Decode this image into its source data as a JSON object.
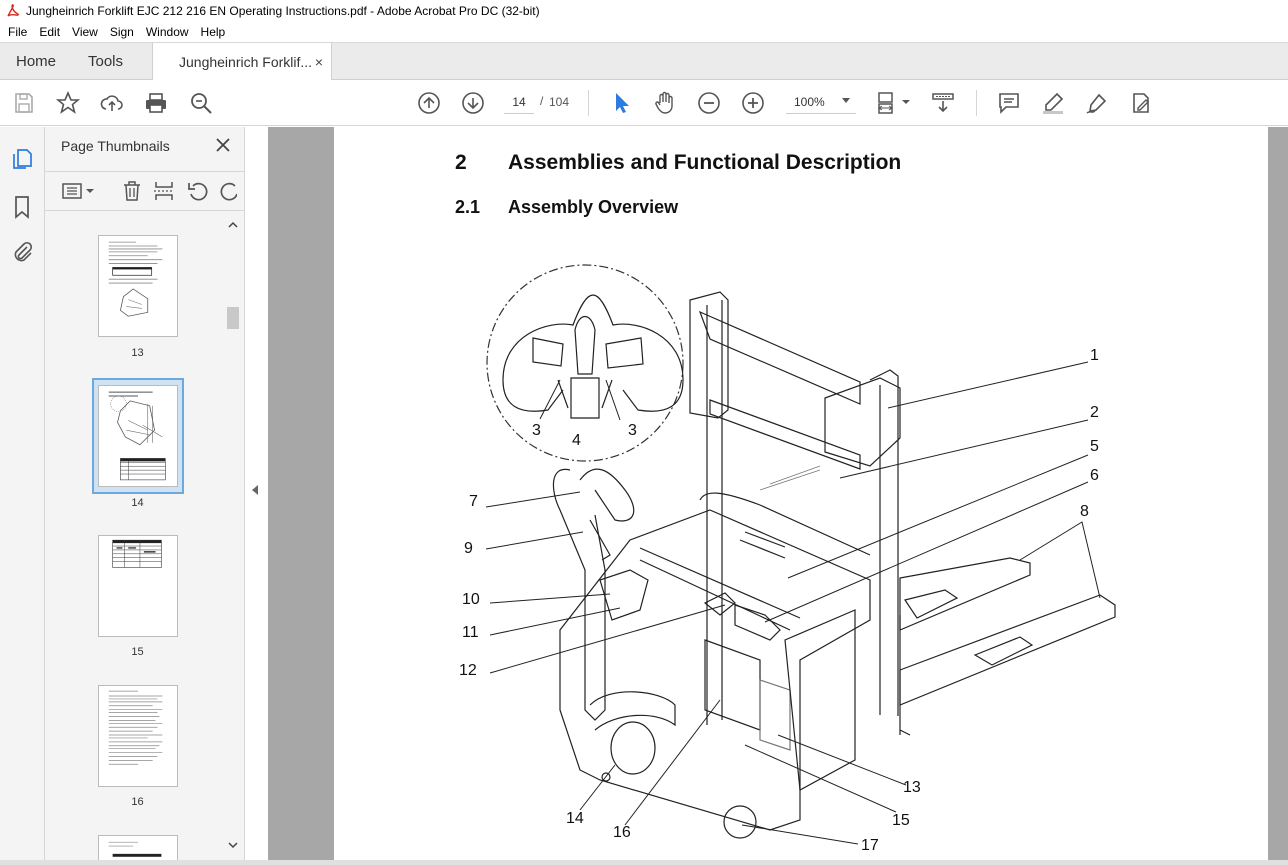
{
  "window": {
    "title": "Jungheinrich Forklift EJC 212 216 EN Operating Instructions.pdf - Adobe Acrobat Pro DC (32-bit)"
  },
  "menu": [
    "File",
    "Edit",
    "View",
    "Sign",
    "Window",
    "Help"
  ],
  "tabs": {
    "home": "Home",
    "tools": "Tools",
    "document": "Jungheinrich Forklif...",
    "close_glyph": "×"
  },
  "toolbar": {
    "page_current": "14",
    "page_separator": "/",
    "page_total": "104",
    "zoom": "100%"
  },
  "thumbnails": {
    "panel_title": "Page Thumbnails",
    "pages": [
      {
        "label": "13",
        "selected": false
      },
      {
        "label": "14",
        "selected": true
      },
      {
        "label": "15",
        "selected": false
      },
      {
        "label": "16",
        "selected": false
      }
    ]
  },
  "document": {
    "heading1_number": "2",
    "heading1_text": "Assemblies and Functional Description",
    "heading2_number": "2.1",
    "heading2_text": "Assembly Overview",
    "callouts": [
      "1",
      "2",
      "3",
      "4",
      "3",
      "5",
      "6",
      "7",
      "8",
      "9",
      "10",
      "11",
      "12",
      "13",
      "14",
      "15",
      "16",
      "17"
    ]
  },
  "colors": {
    "accent_blue": "#2d7be0",
    "app_red": "#d6271c",
    "doc_bg": "#a7a7a7",
    "panel_bg": "#f4f4f4"
  }
}
